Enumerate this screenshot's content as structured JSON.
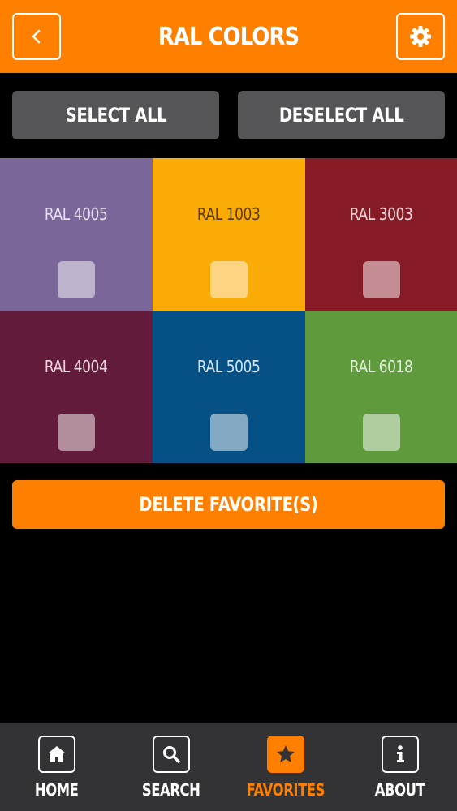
{
  "header": {
    "title": "RAL COLORS",
    "back_icon": "chevron-left-icon",
    "settings_icon": "gear-icon",
    "color": "#ff7f00"
  },
  "actions": {
    "select_all": "SELECT ALL",
    "deselect_all": "DESELECT ALL",
    "delete": "DELETE FAVORITE(S)"
  },
  "colors": [
    {
      "name": "RAL 4005",
      "hex": "#7a6699",
      "text": "#e6dff0",
      "checked": false
    },
    {
      "name": "RAL 1003",
      "hex": "#fbab05",
      "text": "#5a3a00",
      "checked": false
    },
    {
      "name": "RAL 3003",
      "hex": "#861b26",
      "text": "#f0d5d8",
      "checked": false
    },
    {
      "name": "RAL 4004",
      "hex": "#631b3b",
      "text": "#ecd6df",
      "checked": false
    },
    {
      "name": "RAL 5005",
      "hex": "#055085",
      "text": "#d4e4f2",
      "checked": false
    },
    {
      "name": "RAL 6018",
      "hex": "#5f9b3d",
      "text": "#e3f0d9",
      "checked": false
    }
  ],
  "tabs": [
    {
      "label": "HOME",
      "icon": "home-icon",
      "active": false
    },
    {
      "label": "SEARCH",
      "icon": "search-icon",
      "active": false
    },
    {
      "label": "FAVORITES",
      "icon": "star-icon",
      "active": true
    },
    {
      "label": "ABOUT",
      "icon": "info-icon",
      "active": false
    }
  ]
}
